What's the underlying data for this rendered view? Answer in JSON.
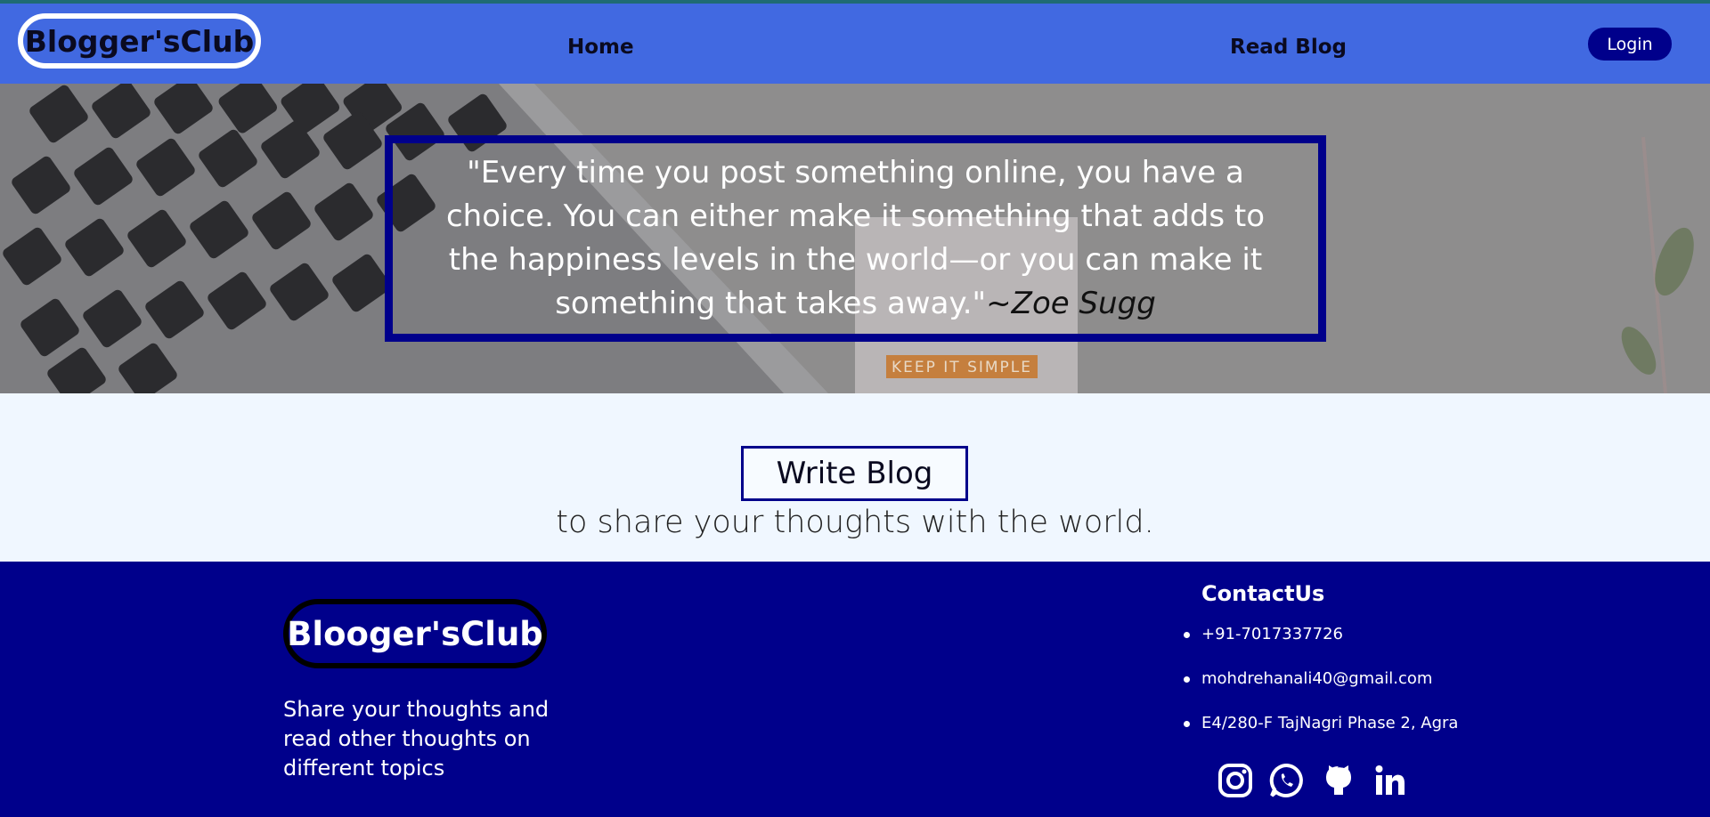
{
  "header": {
    "brand": "Blogger'sClub",
    "nav": {
      "home": "Home",
      "read_blog": "Read Blog"
    },
    "login": "Login"
  },
  "hero": {
    "quote": "\"Every time you post something online, you have a choice. You can either make it something that adds to the happiness levels in the world—or you can make it something that takes away.\"",
    "author": "~Zoe Sugg",
    "notebook_text": "KEEP IT SIMPLE"
  },
  "write": {
    "button": "Write Blog",
    "subtitle": "to share your thoughts with the world."
  },
  "footer": {
    "brand": "Blooger'sClub",
    "tagline": "Share your thoughts and read other thoughts on different topics",
    "contact_title": "ContactUs",
    "phone": "+91-7017337726",
    "email": "mohdrehanali40@gmail.com",
    "address": "E4/280-F TajNagri Phase 2, Agra",
    "socials": [
      "instagram-icon",
      "whatsapp-icon",
      "github-icon",
      "linkedin-icon"
    ]
  },
  "colors": {
    "header_bg": "#4169e1",
    "accent": "#00008b",
    "page_bg": "#f0f7ff"
  }
}
